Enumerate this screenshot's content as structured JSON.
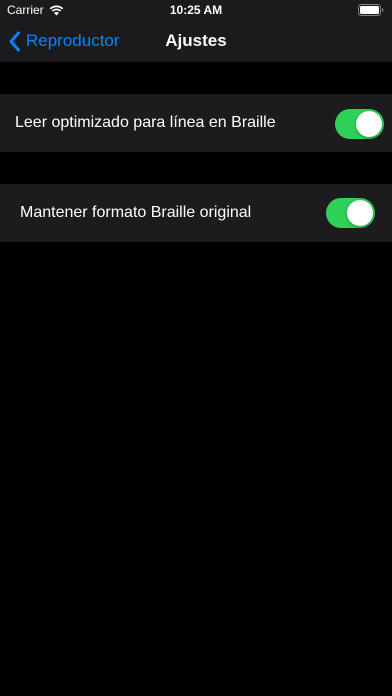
{
  "status_bar": {
    "carrier": "Carrier",
    "time": "10:25 AM",
    "wifi_icon": "wifi-icon",
    "battery_icon": "battery-icon"
  },
  "nav": {
    "back_label": "Reproductor",
    "back_icon": "chevron-left-icon",
    "title": "Ajustes"
  },
  "settings": [
    {
      "label": "Leer optimizado para línea en Braille",
      "enabled": true
    },
    {
      "label": "Mantener formato Braille original",
      "enabled": true
    }
  ],
  "colors": {
    "accent": "#0a84ff",
    "toggle_on": "#30d158",
    "background": "#000000",
    "bar_background": "#1b1b1d",
    "cell_background": "#1c1c1e"
  }
}
